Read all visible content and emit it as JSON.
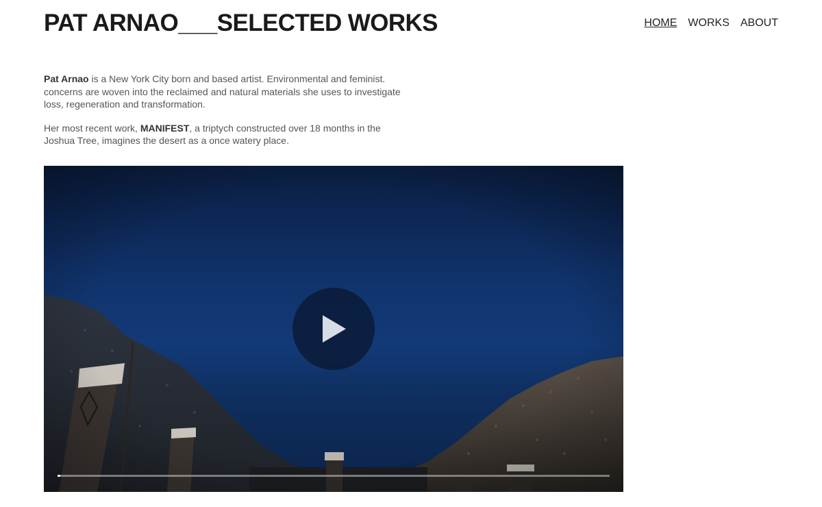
{
  "site": {
    "title": "PAT ARNAO___SELECTED WORKS"
  },
  "nav": {
    "items": [
      {
        "label": "HOME",
        "active": true
      },
      {
        "label": "WORKS",
        "active": false
      },
      {
        "label": "ABOUT",
        "active": false
      }
    ]
  },
  "intro": {
    "p1_name": "Pat Arnao",
    "p1_text": " is a New York City born and based artist. Environmental and feminist. concerns are woven into the reclaimed and natural materials she uses to investigate loss, regeneration and transformation.",
    "p2_prefix": "Her most recent work, ",
    "p2_work": "MANIFEST",
    "p2_suffix": ", a triptych constructed over 18 months in the Joshua Tree, imagines the desert as a once watery place."
  },
  "video": {
    "play_icon": "play-icon",
    "progress": 0.005
  },
  "colors": {
    "sky_top": "#0b1e42",
    "sky_mid": "#123a78",
    "play_bg": "#0a1832"
  }
}
